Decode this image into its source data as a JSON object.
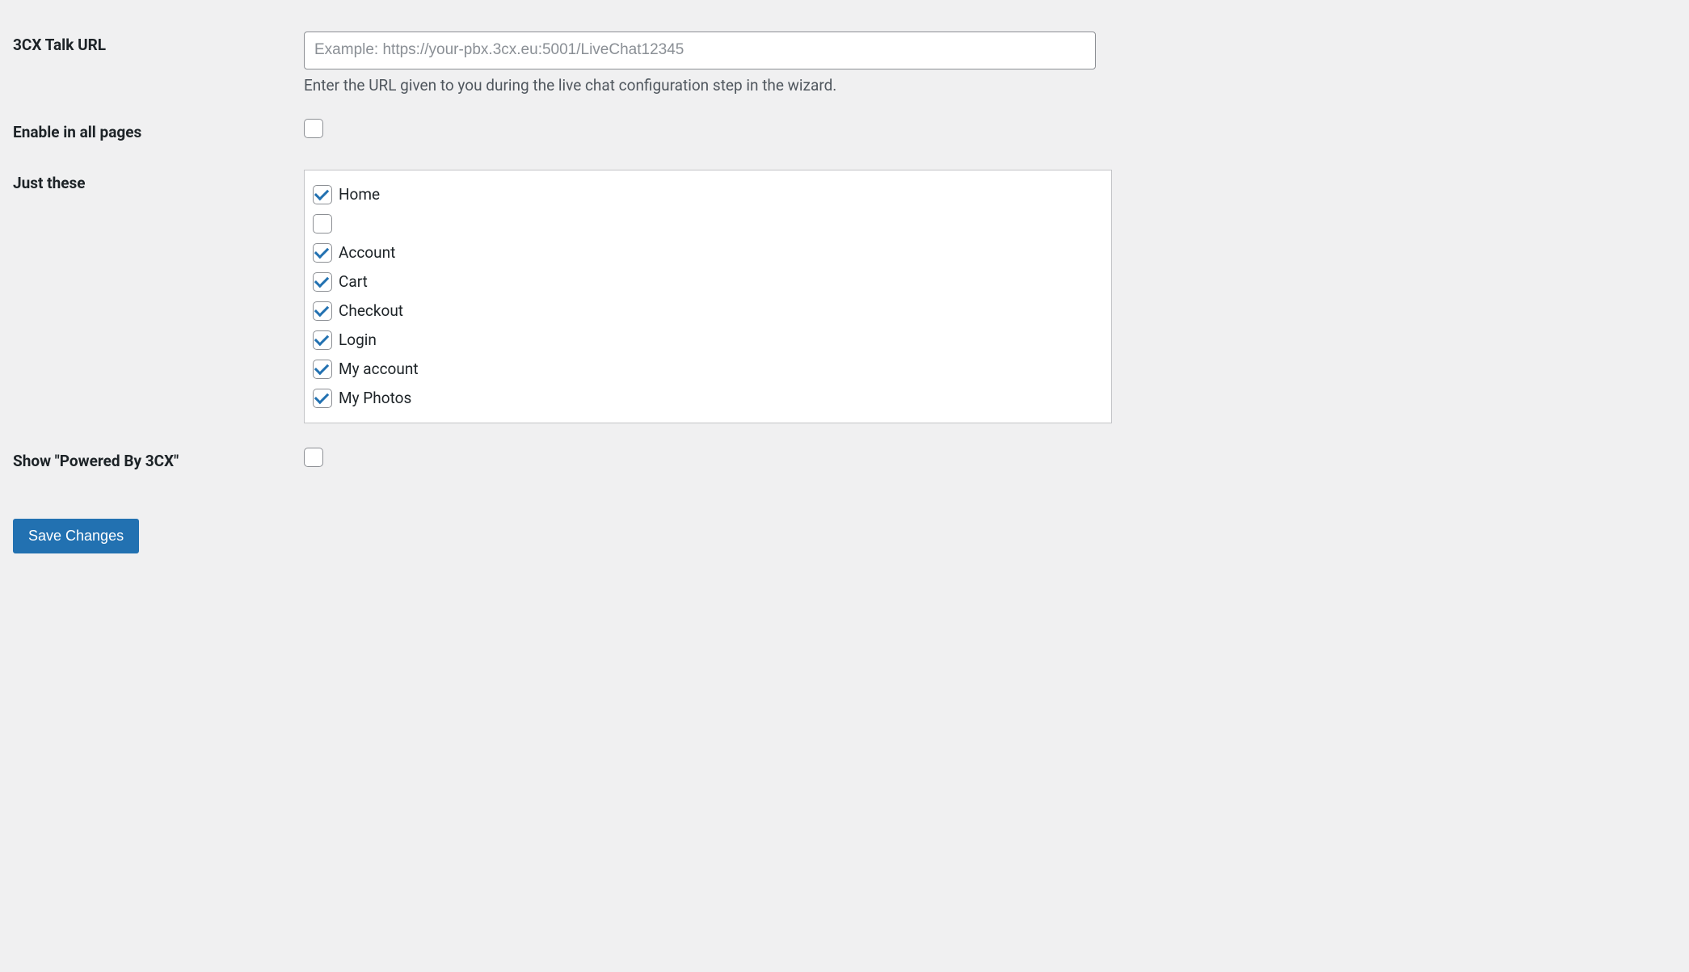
{
  "fields": {
    "talk_url": {
      "label": "3CX Talk URL",
      "placeholder": "Example: https://your-pbx.3cx.eu:5001/LiveChat12345",
      "value": "",
      "description": "Enter the URL given to you during the live chat configuration step in the wizard."
    },
    "enable_all": {
      "label": "Enable in all pages",
      "checked": false
    },
    "just_these": {
      "label": "Just these",
      "pages": [
        {
          "label": "Home",
          "checked": true
        },
        {
          "label": "",
          "checked": false
        },
        {
          "label": "Account",
          "checked": true
        },
        {
          "label": "Cart",
          "checked": true
        },
        {
          "label": "Checkout",
          "checked": true
        },
        {
          "label": "Login",
          "checked": true
        },
        {
          "label": "My account",
          "checked": true
        },
        {
          "label": "My Photos",
          "checked": true
        }
      ]
    },
    "powered_by": {
      "label": "Show \"Powered By 3CX\"",
      "checked": false
    }
  },
  "submit": {
    "label": "Save Changes"
  }
}
